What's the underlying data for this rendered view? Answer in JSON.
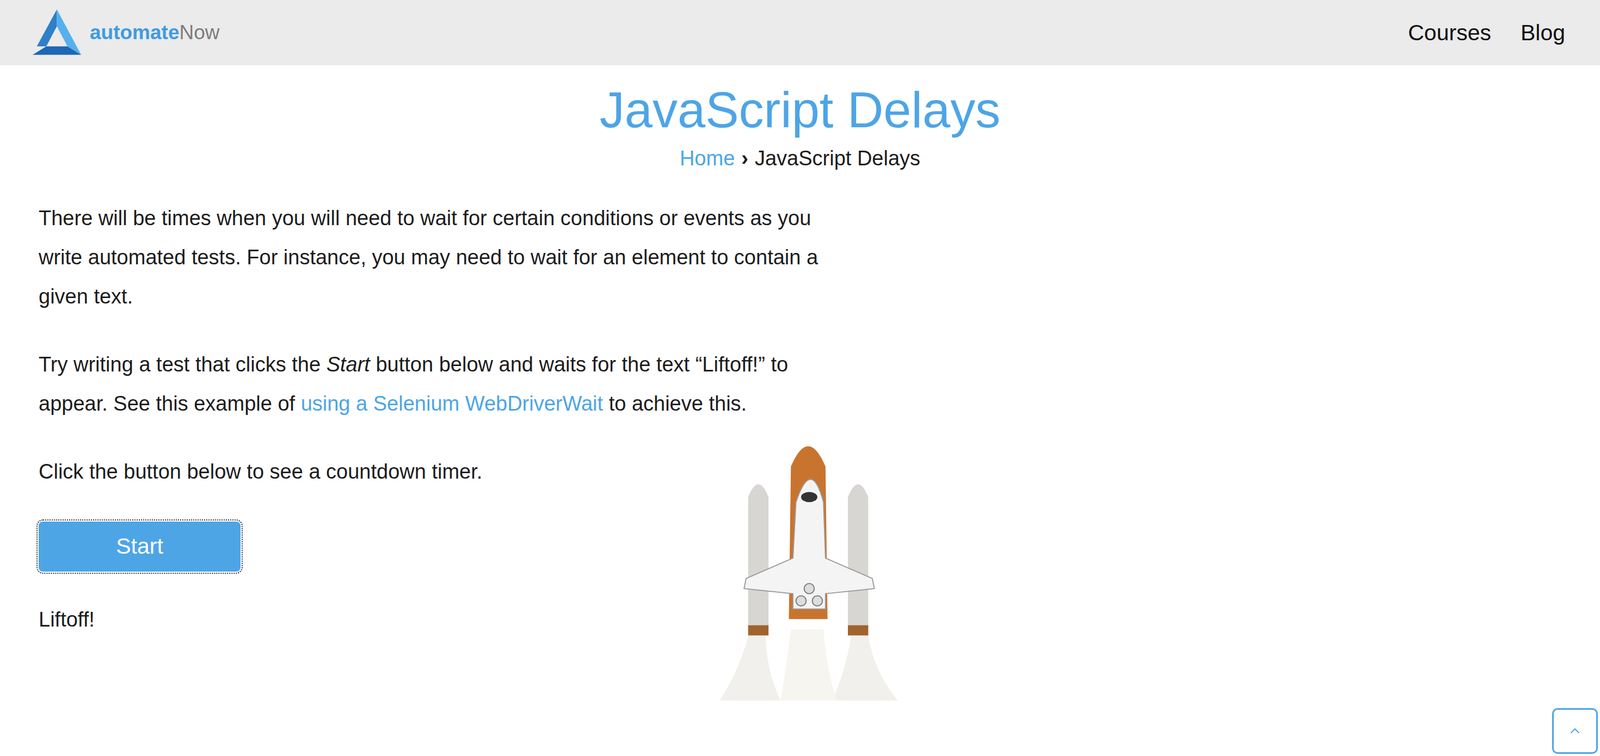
{
  "header": {
    "logo": {
      "brand": "automate",
      "suffix": "Now"
    },
    "nav": [
      {
        "label": "Courses"
      },
      {
        "label": "Blog"
      }
    ]
  },
  "page": {
    "title": "JavaScript Delays",
    "breadcrumb": {
      "home": "Home",
      "separator": "›",
      "current": "JavaScript Delays"
    },
    "paragraphs": [
      [
        {
          "text": "There will be times when you will need to wait for certain conditions or events as you write automated tests. For instance, you may need to wait for an element to contain a given text.",
          "kind": "plain"
        }
      ],
      [
        {
          "text": "Try writing a test that clicks the ",
          "kind": "plain"
        },
        {
          "text": "Start",
          "kind": "italic"
        },
        {
          "text": " button below and waits for the text “Liftoff!” to appear. See this example of ",
          "kind": "plain"
        },
        {
          "text": "using a Selenium WebDriverWait",
          "kind": "link"
        },
        {
          "text": " to achieve this.",
          "kind": "plain"
        }
      ],
      [
        {
          "text": "Click the button below to see a countdown timer.",
          "kind": "plain"
        }
      ]
    ],
    "start_button": {
      "label": "Start",
      "focused": true
    },
    "status": "Liftoff!"
  }
}
